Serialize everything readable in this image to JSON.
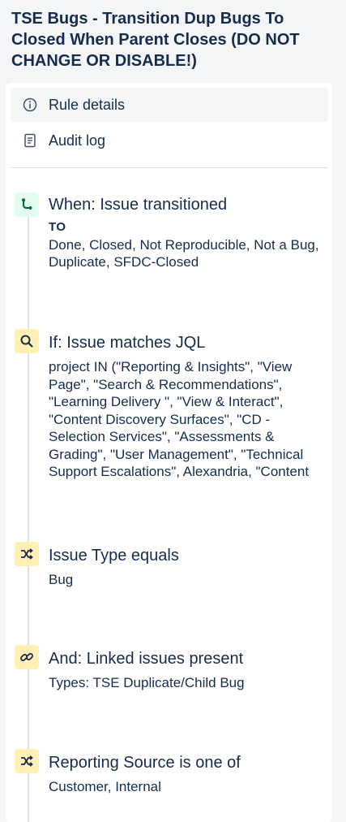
{
  "page": {
    "title": "TSE Bugs - Transition Dup Bugs To Closed When Parent Closes (DO NOT CHANGE OR DISABLE!)"
  },
  "nav": {
    "rule_details": "Rule details",
    "audit_log": "Audit log"
  },
  "steps": [
    {
      "icon": "branch-icon",
      "title": "When: Issue transitioned",
      "sub_label": "TO",
      "body": "Done, Closed, Not Reproducible, Not a Bug, Duplicate, SFDC-Closed"
    },
    {
      "icon": "search-icon",
      "title": "If: Issue matches JQL",
      "body": "project IN (\"Reporting & Insights\", \"View Page\", \"Search & Recommendations\", \"Learning Delivery \", \"View & Interact\", \"Content Discovery Surfaces\", \"CD - Selection Services\", \"Assessments & Grading\", \"User Management\", \"Technical Support Escalations\", Alexandria, \"Content Distribution\""
    },
    {
      "icon": "shuffle-icon",
      "title": "Issue Type equals",
      "body": "Bug"
    },
    {
      "icon": "link-icon",
      "title": "And: Linked issues present",
      "body": "Types: TSE Duplicate/Child Bug"
    },
    {
      "icon": "shuffle-icon",
      "title": "Reporting Source is one of",
      "body": "Customer, Internal"
    }
  ],
  "colors": {
    "trigger_icon_bg": "#e3fcef",
    "condition_icon_bg": "#fff0b3",
    "selected_nav_bg": "#f4f5f7"
  }
}
